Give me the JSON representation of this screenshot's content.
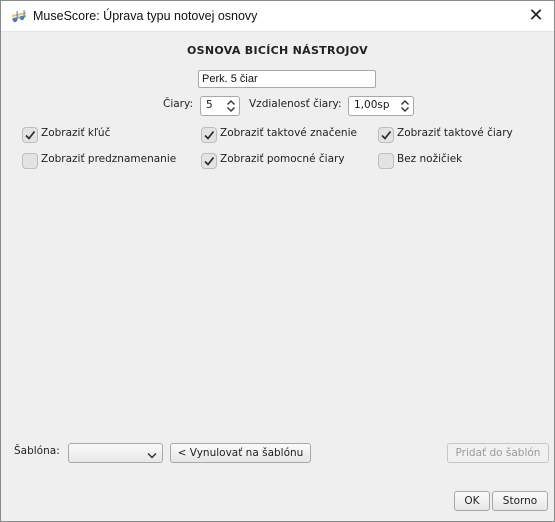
{
  "window": {
    "title": "MuseScore: Úprava typu notovej osnovy",
    "app_icon": "musescore-app-icon",
    "close_glyph": "✕"
  },
  "dialog": {
    "heading": "OSNOVA BICÍCH NÁSTROJOV",
    "name_value": "Perk. 5 čiar",
    "lines_label": "Čiary:",
    "lines_value": "5",
    "spacing_label": "Vzdialenosť čiary:",
    "spacing_value": "1,00sp"
  },
  "checkboxes": [
    {
      "label": "Zobraziť kľúč",
      "checked": true
    },
    {
      "label": "Zobraziť taktové značenie",
      "checked": true
    },
    {
      "label": "Zobraziť taktové čiary",
      "checked": true
    },
    {
      "label": "Zobraziť predznamenanie",
      "checked": false
    },
    {
      "label": "Zobraziť pomocné čiary",
      "checked": true
    },
    {
      "label": "Bez nožičiek",
      "checked": false
    }
  ],
  "footer": {
    "template_label": "Šablóna:",
    "template_value": "",
    "reset_button": "< Vynulovať na šablónu",
    "add_button": "Pridať do šablón",
    "ok_button": "OK",
    "cancel_button": "Storno"
  },
  "colors": {
    "dialog_bg": "#efefef",
    "checkmark": "#2b2b2b",
    "disabled_text": "#9a9a9a",
    "icon_accent": "#e8a33a"
  }
}
